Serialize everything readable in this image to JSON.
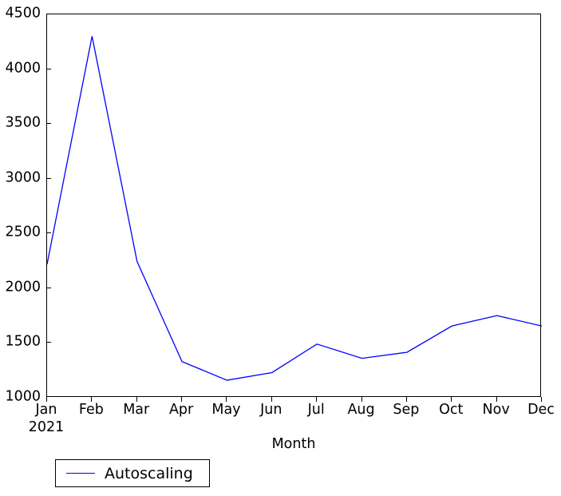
{
  "chart_data": {
    "type": "line",
    "title": "",
    "subtitle": "",
    "xlabel": "Month",
    "ylabel": "",
    "categories": [
      "Jan",
      "Feb",
      "Mar",
      "Apr",
      "May",
      "Jun",
      "Jul",
      "Aug",
      "Sep",
      "Oct",
      "Nov",
      "Dec"
    ],
    "x_sublabels": [
      "2021",
      "",
      "",
      "",
      "",
      "",
      "",
      "",
      "",
      "",
      "",
      ""
    ],
    "series": [
      {
        "name": "Autoscaling",
        "color": "#0000ff",
        "values": [
          2220,
          4300,
          2245,
          1330,
          1160,
          1230,
          1490,
          1360,
          1415,
          1655,
          1750,
          1655
        ]
      }
    ],
    "ylim": [
      1000,
      4500
    ],
    "y_ticks": [
      1000,
      1500,
      2000,
      2500,
      3000,
      3500,
      4000,
      4500
    ],
    "y_tick_labels": [
      "1000",
      "1500",
      "2000",
      "2500",
      "3000",
      "3500",
      "4000",
      "4500"
    ],
    "xlim_categories": [
      0,
      11
    ],
    "grid": false,
    "legend": {
      "position": "below-axes-left",
      "entries": [
        {
          "label": "Autoscaling",
          "color": "#0000ff",
          "marker": "line"
        }
      ]
    },
    "style": {
      "background": "#ffffff",
      "axes_edge_color": "#000000",
      "tick_color": "#000000",
      "text_color": "#000000",
      "line_width": 1.3
    }
  }
}
